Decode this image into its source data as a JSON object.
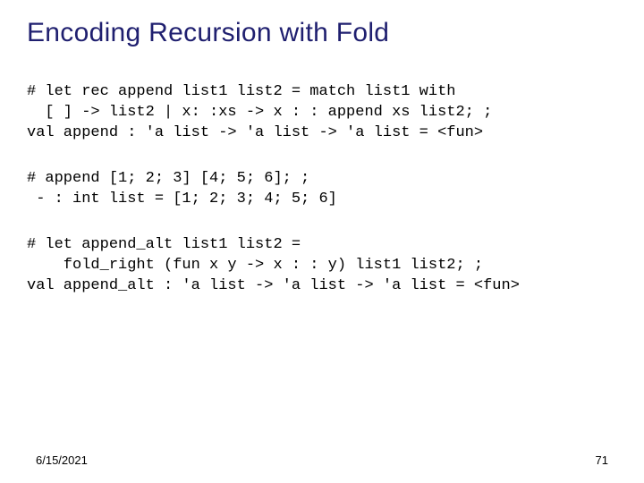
{
  "title": "Encoding Recursion with Fold",
  "code1": "# let rec append list1 list2 = match list1 with\n  [ ] -> list2 | x: :xs -> x : : append xs list2; ;\nval append : 'a list -> 'a list -> 'a list = <fun>",
  "code2": "# append [1; 2; 3] [4; 5; 6]; ;\n - : int list = [1; 2; 3; 4; 5; 6]",
  "code3": "# let append_alt list1 list2 =\n    fold_right (fun x y -> x : : y) list1 list2; ;\nval append_alt : 'a list -> 'a list -> 'a list = <fun>",
  "footer": {
    "date": "6/15/2021",
    "page": "71"
  }
}
